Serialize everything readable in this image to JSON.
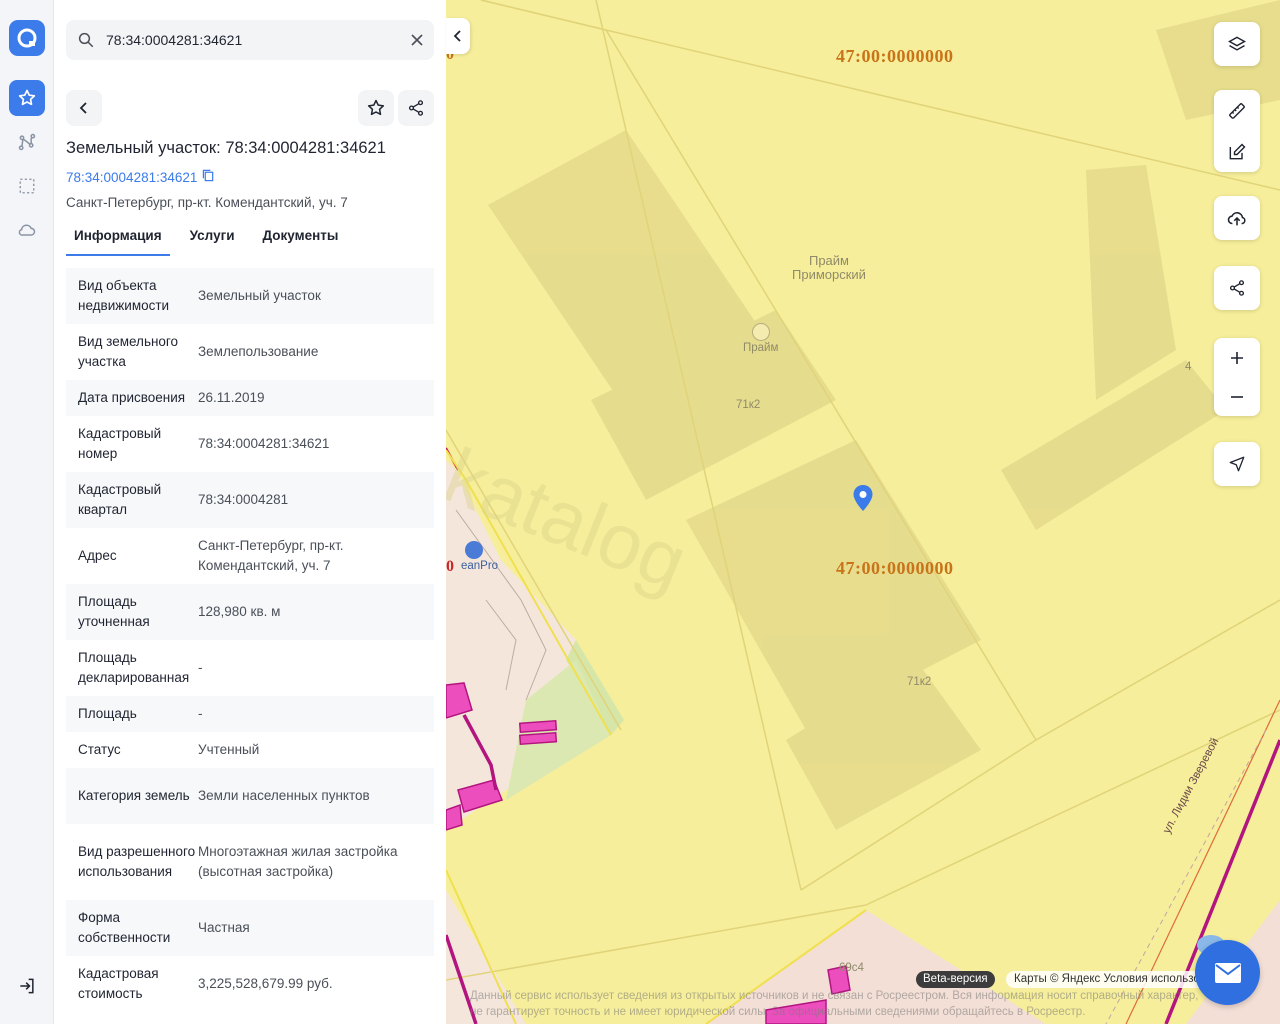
{
  "rail": {
    "items": [
      {
        "icon": "app-logo"
      },
      {
        "icon": "star-icon",
        "active": true
      },
      {
        "icon": "route-icon"
      },
      {
        "icon": "selection-icon"
      },
      {
        "icon": "cloud-icon"
      }
    ],
    "logout_icon": "logout-icon"
  },
  "search": {
    "value": "78:34:0004281:34621"
  },
  "object": {
    "title": "Земельный участок: 78:34:0004281:34621",
    "cad_link": "78:34:0004281:34621",
    "address": "Санкт-Петербург, пр-кт. Комендантский, уч. 7"
  },
  "tabs": [
    {
      "label": "Информация",
      "active": true
    },
    {
      "label": "Услуги"
    },
    {
      "label": "Документы"
    }
  ],
  "info": [
    {
      "key": "Вид объекта недвижимости",
      "value": "Земельный участок"
    },
    {
      "key": "Вид земельного участка",
      "value": "Землепользование"
    },
    {
      "key": "Дата присвоения",
      "value": "26.11.2019"
    },
    {
      "key": "Кадастровый номер",
      "value": "78:34:0004281:34621"
    },
    {
      "key": "Кадастровый квартал",
      "value": "78:34:0004281"
    },
    {
      "key": "Адрес",
      "value": "Санкт-Петербург, пр-кт. Комендантский, уч. 7"
    },
    {
      "key": "Площадь уточненная",
      "value": "128,980 кв. м"
    },
    {
      "key": "Площадь декларированная",
      "value": "-"
    },
    {
      "key": "Площадь",
      "value": "-"
    },
    {
      "key": "Статус",
      "value": "Учтенный"
    },
    {
      "key": "Категория земель",
      "value": "Земли населенных пунктов"
    },
    {
      "key": "Вид разрешенного использования",
      "value": "Многоэтажная жилая застройка (высотная застройка)"
    },
    {
      "key": "Форма собственности",
      "value": "Частная"
    },
    {
      "key": "Кадастровая стоимость",
      "value": "3,225,528,679.99 руб."
    }
  ],
  "map": {
    "label_top": "47:00:0000000",
    "label_mid": "47:00:0000000",
    "label_edge": "0",
    "label_edge_left": "0",
    "place_name": "Прайм\nПриморский",
    "poi": "Прайм",
    "poi_car": "eanPro",
    "bld1": "71к2",
    "bld2": "71к2",
    "bld3": "4",
    "bld4": "69с4",
    "street": "ул. Лидии Зверевой",
    "watermark": "katalog",
    "beta": "Beta-версия",
    "attribution": "Карты © Яндекс  Условия использования",
    "disclaimer_1": "Данный сервис использует сведения из открытых источников и не связан с Росреестром. Вся информация носит справочный характер,",
    "disclaimer_2": "не гарантирует точность и не имеет юридической силы. За официальными сведениями обращайтесь в Росреестр."
  }
}
